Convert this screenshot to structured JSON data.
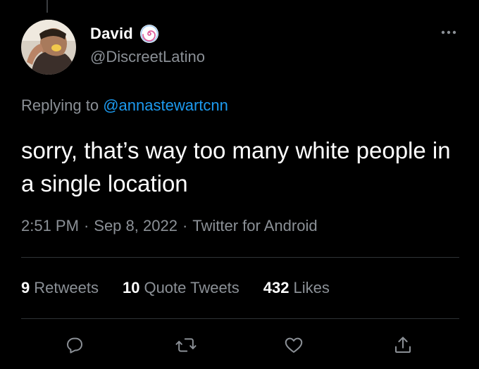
{
  "tweet": {
    "author": {
      "display_name": "David",
      "handle": "@DiscreetLatino",
      "badge_icon": "swirl-emoji-icon",
      "avatar_icon": "profile-photo"
    },
    "replying_prefix": "Replying to",
    "replying_to": "@annastewartcnn",
    "text": "sorry, that’s way too many white people in a single location",
    "time": "2:51 PM",
    "date": "Sep 8, 2022",
    "source": "Twitter for Android",
    "separator": "·"
  },
  "stats": {
    "retweets_count": "9",
    "retweets_label": "Retweets",
    "quote_count": "10",
    "quote_label": "Quote Tweets",
    "likes_count": "432",
    "likes_label": "Likes"
  },
  "actions": [
    {
      "icon": "reply-icon"
    },
    {
      "icon": "retweet-icon"
    },
    {
      "icon": "like-icon"
    },
    {
      "icon": "share-icon"
    }
  ],
  "colors": {
    "background": "#000000",
    "primary_text": "#ffffff",
    "secondary_text": "#8b9096",
    "link": "#1d9bf0",
    "divider": "#2f3336"
  }
}
